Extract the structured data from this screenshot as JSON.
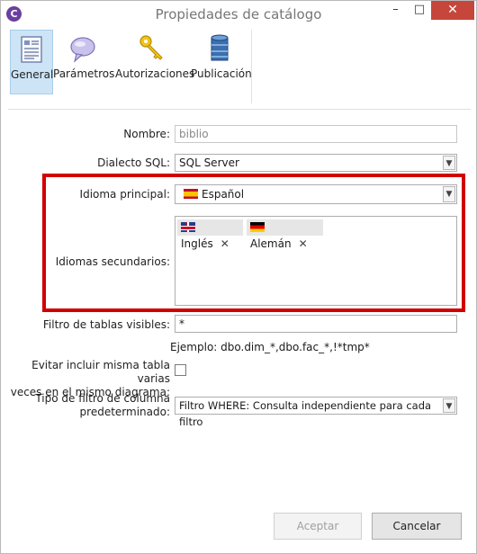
{
  "window": {
    "title": "Propiedades de catálogo",
    "min": "–",
    "max": "□",
    "close": "✕",
    "app_glyph": "C"
  },
  "toolbar": {
    "tabs": [
      {
        "label": "General",
        "icon": "document-list-icon",
        "active": true
      },
      {
        "label": "Parámetros",
        "icon": "speech-bubble-icon",
        "active": false
      },
      {
        "label": "Autorizaciones",
        "icon": "keys-icon",
        "active": false
      },
      {
        "label": "Publicación",
        "icon": "database-icon",
        "active": false
      }
    ]
  },
  "form": {
    "name_label": "Nombre:",
    "name_value": "biblio",
    "dialect_label": "Dialecto SQL:",
    "dialect_value": "SQL Server",
    "primary_lang_label": "Idioma principal:",
    "primary_lang_value": "Español",
    "secondary_lang_label": "Idiomas secundarios:",
    "secondary_langs": [
      {
        "label": "Inglés",
        "remove": "✕"
      },
      {
        "label": "Alemán",
        "remove": "✕"
      }
    ],
    "table_filter_label": "Filtro de tablas visibles:",
    "table_filter_value": "*",
    "example_text": "Ejemplo: dbo.dim_*,dbo.fac_*,!*tmp*",
    "avoid_label_line1": "Evitar incluir misma tabla varias",
    "avoid_label_line2": "veces en el mismo diagrama:",
    "avoid_checked": false,
    "column_filter_label_line1": "Tipo de filtro de columna",
    "column_filter_label_line2": "predeterminado:",
    "column_filter_value": "Filtro WHERE: Consulta independiente para cada filtro"
  },
  "buttons": {
    "accept": "Aceptar",
    "cancel": "Cancelar"
  },
  "colors": {
    "highlight_frame": "#d10000",
    "active_tab": "#cde4f7",
    "close_button": "#c7463c"
  }
}
